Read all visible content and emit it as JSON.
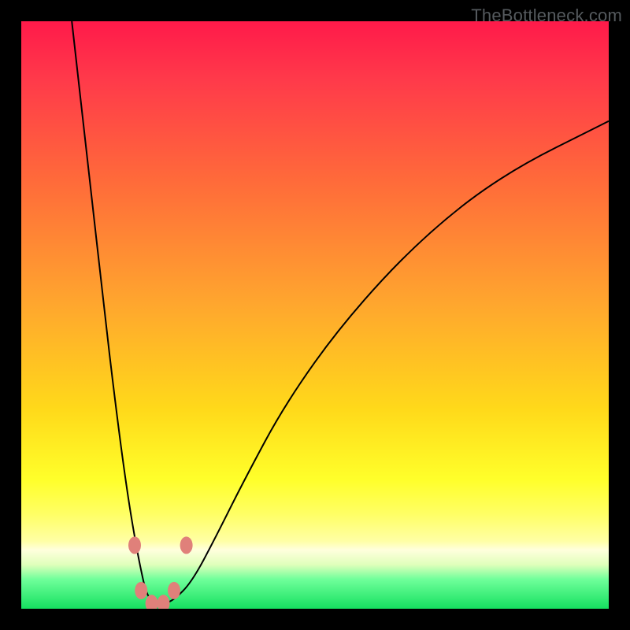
{
  "brand": "TheBottleneck.com",
  "colors": {
    "frame_bg_gradient_top": "#ff1a4a",
    "frame_bg_gradient_bottom": "#15e060",
    "curve_stroke": "#000000",
    "dot_fill": "#e0807a",
    "page_bg": "#000000",
    "brand_text": "#555a5e"
  },
  "chart_data": {
    "type": "line",
    "title": "",
    "xlabel": "",
    "ylabel": "",
    "xlim": [
      0,
      100
    ],
    "ylim": [
      0,
      100
    ],
    "series": [
      {
        "name": "curve",
        "x": [
          8.6,
          12,
          14,
          16,
          18,
          19.5,
          20.5,
          21.2,
          22,
          23,
          24,
          26,
          29,
          33,
          38,
          45,
          55,
          68,
          82,
          100
        ],
        "y": [
          100,
          70,
          52,
          35,
          20,
          11,
          6,
          3,
          1.5,
          0.7,
          0.7,
          1.5,
          4.5,
          12,
          22,
          35,
          49,
          63,
          74,
          83
        ]
      }
    ],
    "markers": [
      {
        "x": 19.3,
        "y": 10.8
      },
      {
        "x": 20.4,
        "y": 3.1
      },
      {
        "x": 22.2,
        "y": 0.9
      },
      {
        "x": 24.2,
        "y": 0.9
      },
      {
        "x": 26.0,
        "y": 3.1
      },
      {
        "x": 28.1,
        "y": 10.8
      }
    ]
  }
}
